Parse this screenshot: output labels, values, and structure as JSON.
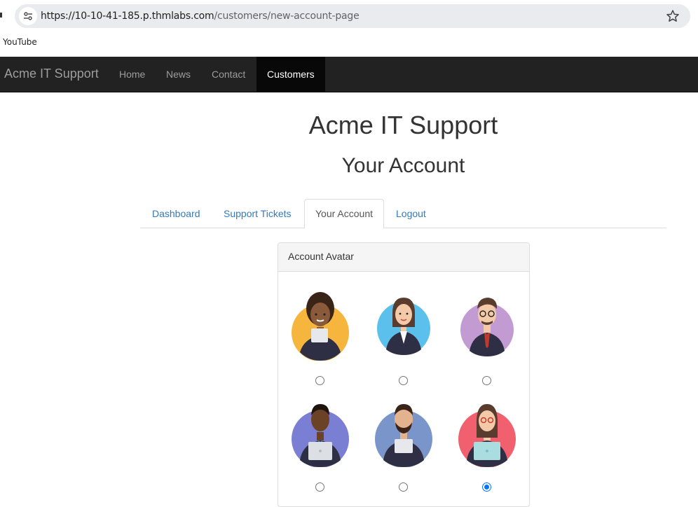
{
  "browser": {
    "url_host": "https://10-10-41-185.p.thmlabs.com",
    "url_path": "/customers/new-account-page",
    "bookmarks": [
      {
        "label": "YouTube"
      }
    ]
  },
  "navbar": {
    "brand": "Acme IT Support",
    "items": [
      {
        "label": "Home",
        "active": false
      },
      {
        "label": "News",
        "active": false
      },
      {
        "label": "Contact",
        "active": false
      },
      {
        "label": "Customers",
        "active": true
      }
    ]
  },
  "page": {
    "title": "Acme IT Support",
    "subtitle": "Your Account"
  },
  "tabs": [
    {
      "label": "Dashboard",
      "active": false
    },
    {
      "label": "Support Tickets",
      "active": false
    },
    {
      "label": "Your Account",
      "active": true
    },
    {
      "label": "Logout",
      "active": false
    }
  ],
  "avatar_panel": {
    "heading": "Account Avatar",
    "avatars": [
      {
        "name": "avatar-woman-curly-hair",
        "bg": "#f6b53d",
        "checked": false
      },
      {
        "name": "avatar-woman-ponytail",
        "bg": "#5bc0eb",
        "checked": false
      },
      {
        "name": "avatar-man-glasses",
        "bg": "#c39bd3",
        "checked": false
      },
      {
        "name": "avatar-man-dark-skin",
        "bg": "#7b7fd4",
        "checked": false
      },
      {
        "name": "avatar-man-beard",
        "bg": "#7a95c9",
        "checked": false
      },
      {
        "name": "avatar-woman-red-glasses",
        "bg": "#f0606e",
        "checked": true
      }
    ]
  },
  "colors": {
    "navbar_bg": "#222222",
    "nav_active_bg": "#080808",
    "link": "#337ab7",
    "radio_checked": "#0075ff"
  }
}
